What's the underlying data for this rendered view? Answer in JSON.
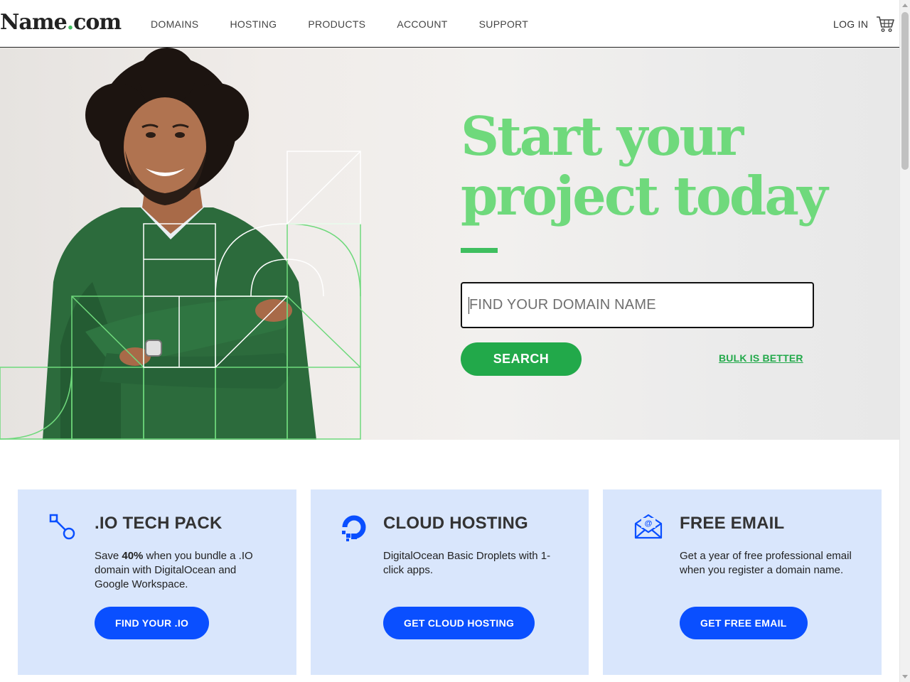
{
  "header": {
    "logo_main": "Name",
    "logo_dot": ".",
    "logo_tld": "com",
    "nav": [
      "DOMAINS",
      "HOSTING",
      "PRODUCTS",
      "ACCOUNT",
      "SUPPORT"
    ],
    "login_label": "LOG IN",
    "cart_icon": "cart-icon"
  },
  "hero": {
    "headline_line1": "Start your",
    "headline_line2": "project today",
    "search_placeholder": "FIND YOUR DOMAIN NAME",
    "search_button": "SEARCH",
    "bulk_link": "BULK IS BETTER"
  },
  "cards": [
    {
      "icon": "key-icon",
      "title": ".IO TECH PACK",
      "text_before": "Save ",
      "text_bold": "40%",
      "text_after": " when you bundle a .IO domain with DigitalOcean and Google Workspace.",
      "button": "FIND YOUR .IO"
    },
    {
      "icon": "digitalocean-icon",
      "title": "CLOUD HOSTING",
      "text": "DigitalOcean Basic Droplets with 1-click apps.",
      "button": "GET CLOUD HOSTING"
    },
    {
      "icon": "email-icon",
      "title": "FREE EMAIL",
      "text": "Get a year of free professional email when you register a domain name.",
      "button": "GET FREE EMAIL"
    }
  ],
  "colors": {
    "brand_green": "#3fbf5f",
    "headline_green": "#6fd97c",
    "search_green": "#22a94a",
    "card_bg": "#d9e6fc",
    "card_button_blue": "#0a4fff"
  }
}
